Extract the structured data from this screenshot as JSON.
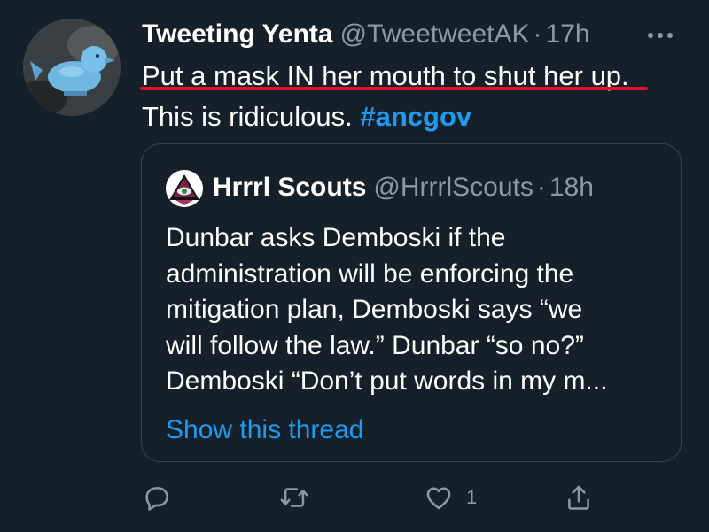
{
  "tweet": {
    "author_name": "Tweeting Yenta",
    "author_handle": "@TweetweetAK",
    "separator": "·",
    "time": "17h",
    "text_line1": "Put a mask IN her mouth to shut her up.",
    "text_line2_prefix": "This is ridiculous.",
    "hashtag": "#ancgov",
    "annotation_color": "#e0132b"
  },
  "quoted_tweet": {
    "author_name": "Hrrrl Scouts",
    "author_handle": "@HrrrlScouts",
    "separator": "·",
    "time": "18h",
    "lines": [
      "Dunbar asks Demboski if the",
      "administration will be enforcing the",
      "mitigation plan, Demboski says “we",
      "will follow the law.” Dunbar “so no?”",
      "Demboski “Don’t put words in my m..."
    ],
    "show_thread": "Show this thread"
  },
  "actions": {
    "reply_icon": "reply-icon",
    "retweet_icon": "retweet-icon",
    "like_icon": "heart-icon",
    "like_count": "1",
    "share_icon": "share-icon"
  },
  "colors": {
    "background": "#15202b",
    "accent": "#1d9bf0",
    "muted": "#8b98a5",
    "border": "#38444d"
  }
}
